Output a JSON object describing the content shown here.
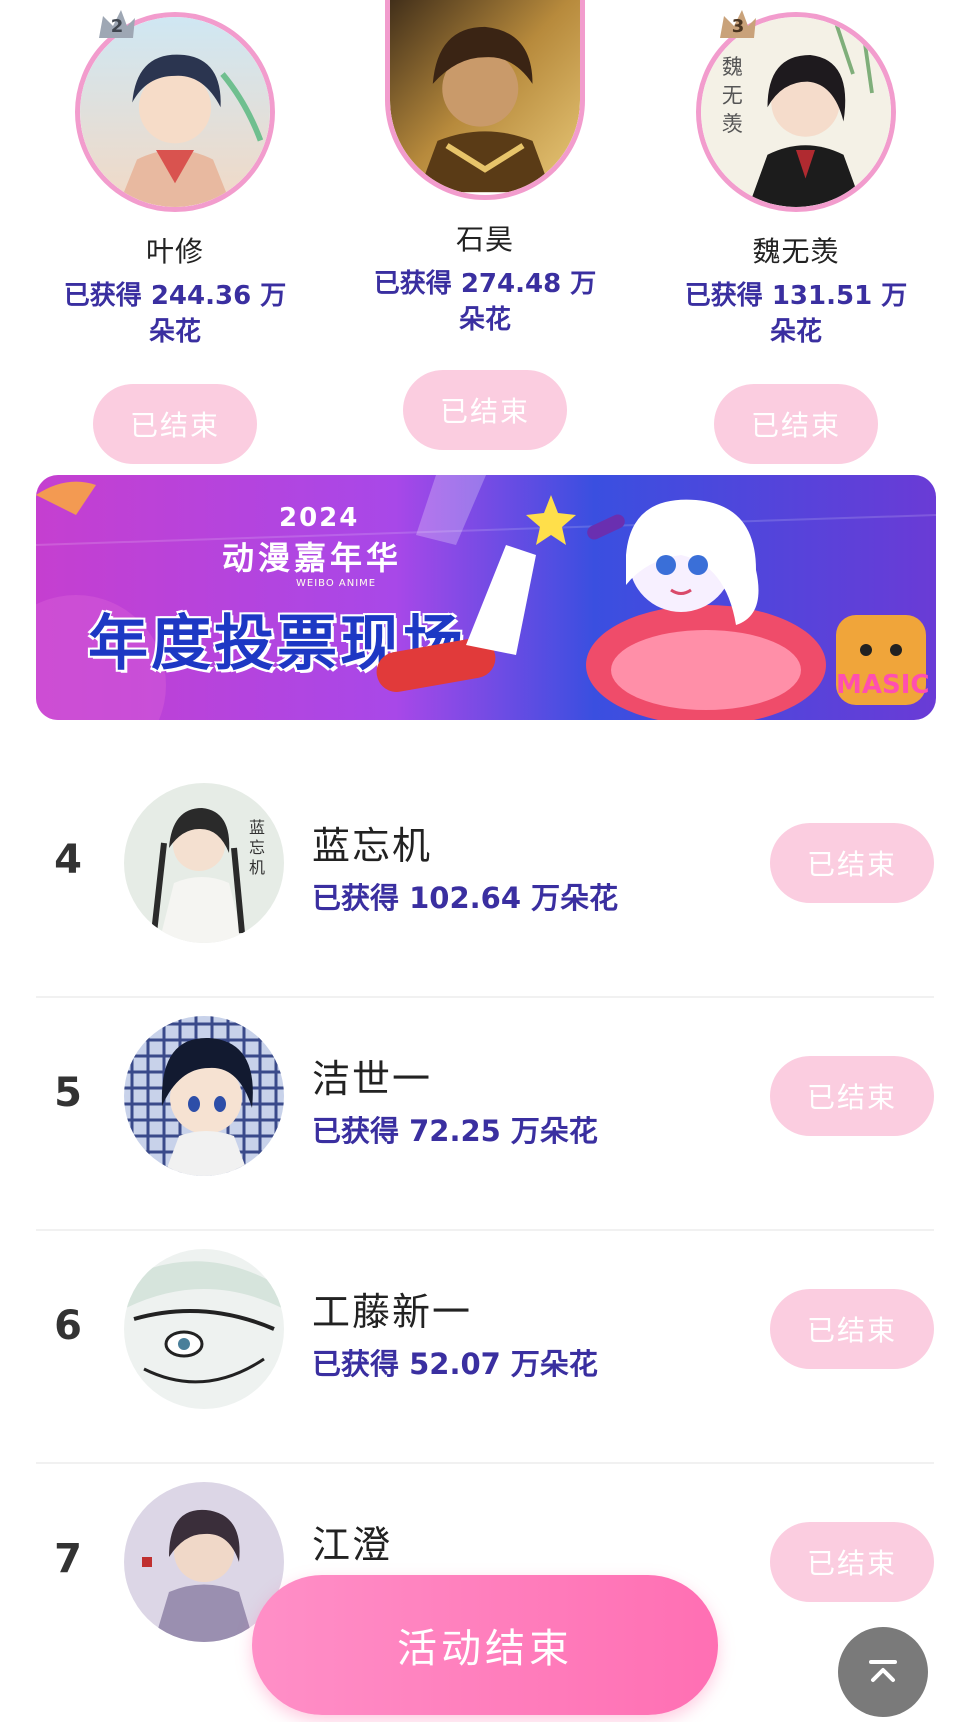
{
  "colors": {
    "accent_pink": "#f29ccd",
    "button_pink": "#fbcde0",
    "score_purple": "#3a2fa0",
    "cta_pink": "#ff8fc7"
  },
  "podium": {
    "second": {
      "rank": "2",
      "name": "叶修",
      "score": "已获得 244.36 万朵花",
      "button": "已结束"
    },
    "first": {
      "name": "石昊",
      "score": "已获得 274.48 万朵花",
      "button": "已结束"
    },
    "third": {
      "rank": "3",
      "name": "魏无羡",
      "score": "已获得 131.51 万朵花",
      "button": "已结束"
    }
  },
  "banner": {
    "year": "2024",
    "subtitle": "动漫嘉年华",
    "mini": "WEIBO ANIME",
    "title": "年度投票现场",
    "mascot_text": "MASIC"
  },
  "ranking": [
    {
      "rank": "4",
      "name": "蓝忘机",
      "score": "已获得 102.64 万朵花",
      "button": "已结束"
    },
    {
      "rank": "5",
      "name": "洁世一",
      "score": "已获得 72.25 万朵花",
      "button": "已结束"
    },
    {
      "rank": "6",
      "name": "工藤新一",
      "score": "已获得 52.07 万朵花",
      "button": "已结束"
    },
    {
      "rank": "7",
      "name": "江澄",
      "score": "",
      "button": "已结束"
    }
  ],
  "cta": {
    "label": "活动结束"
  },
  "icons": {
    "to_top": "arrow-up-to-top-icon"
  }
}
